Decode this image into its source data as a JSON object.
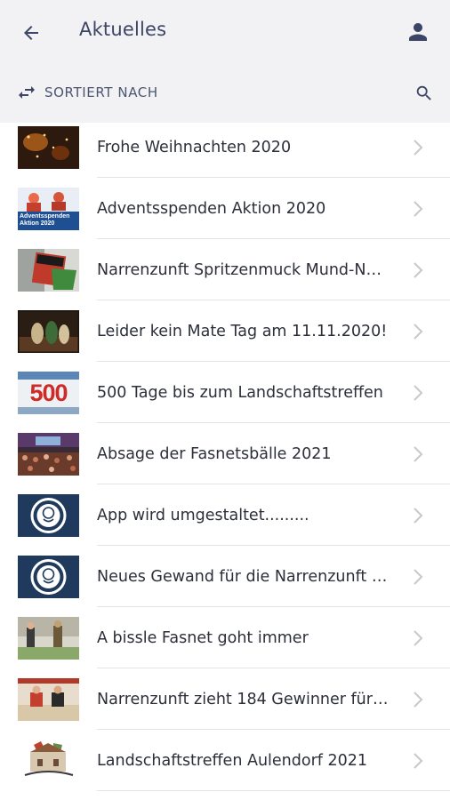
{
  "header": {
    "title": "Aktuelles",
    "back_icon": "arrow-left-icon",
    "profile_icon": "person-icon"
  },
  "sortbar": {
    "label": "SORTIERT NACH",
    "sort_icon": "swap-horizontal-icon",
    "search_icon": "search-icon"
  },
  "colors": {
    "header_bg": "#f2f2f4",
    "title": "#3c4565",
    "icon": "#3c4565",
    "chevron": "#c8c8cc"
  },
  "items": [
    {
      "label": "Frohe Weihnachten 2020",
      "thumb_icon": "christmas-photo-thumbnail"
    },
    {
      "label": "Adventsspenden Aktion 2020",
      "thumb_icon": "adventsspenden-thumbnail",
      "thumb_text": "Adventsspenden Aktion 2020"
    },
    {
      "label": "Narrenzunft Spritzenmuck Mund-N…",
      "thumb_icon": "masks-thumbnail"
    },
    {
      "label": "Leider kein Mate Tag am 11.11.2020!",
      "thumb_icon": "mate-tag-thumbnail"
    },
    {
      "label": "500 Tage bis zum Landschaftstreffen",
      "thumb_icon": "500-tage-thumbnail",
      "thumb_text": "500"
    },
    {
      "label": "Absage der Fasnetsbälle 2021",
      "thumb_icon": "ballroom-thumbnail"
    },
    {
      "label": "App wird umgestaltet.........",
      "thumb_icon": "spritzenmuck-logo-thumbnail"
    },
    {
      "label": "Neues Gewand für die Narrenzunft …",
      "thumb_icon": "spritzenmuck-logo-thumbnail"
    },
    {
      "label": "A bissle Fasnet goht immer",
      "thumb_icon": "costume-photo-thumbnail"
    },
    {
      "label": "Narrenzunft zieht 184 Gewinner für…",
      "thumb_icon": "lottery-photo-thumbnail"
    },
    {
      "label": "Landschaftstreffen Aulendorf 2021",
      "thumb_icon": "aulendorf-logo-thumbnail"
    }
  ]
}
